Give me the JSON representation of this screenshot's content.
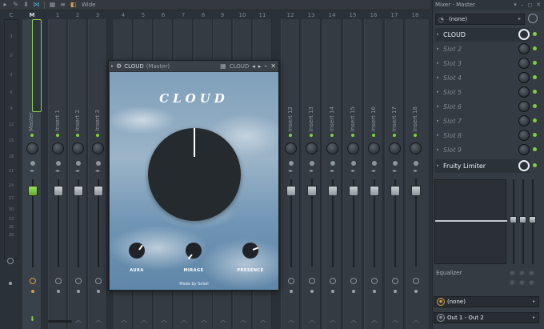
{
  "toolbar": {
    "mode_label": "Wide"
  },
  "columns": {
    "headers": [
      "C",
      "M",
      "1",
      "2",
      "3",
      "4",
      "5",
      "6",
      "7",
      "8",
      "9",
      "10",
      "11",
      "12",
      "13",
      "14",
      "15",
      "16",
      "17",
      "18"
    ]
  },
  "meter": {
    "ticks": [
      "3",
      "0",
      "3",
      "6",
      "9",
      "12",
      "15",
      "18",
      "21",
      "24",
      "27",
      "30",
      "33",
      "36",
      "39"
    ]
  },
  "strips": {
    "master_label": "Master",
    "inserts_left": [
      "Insert 1",
      "Insert 2",
      "Insert 3"
    ],
    "inserts_right": [
      "Insert 12",
      "Insert 13",
      "Insert 14",
      "Insert 15",
      "Insert 16",
      "Insert 17",
      "Insert 18"
    ]
  },
  "plugin": {
    "window_title": "CLOUD",
    "window_subtitle": "(Master)",
    "preset_name": "CLOUD",
    "logo_text": "CLOUD",
    "knobs": [
      "AURA",
      "MIRAGE",
      "PRESENCE"
    ],
    "credit": "Made by Soleil"
  },
  "mixer_panel": {
    "title": "Mixer - Master",
    "preset_select": "(none)",
    "slots": [
      {
        "label": "CLOUD",
        "active": true
      },
      {
        "label": "Slot 2",
        "active": false
      },
      {
        "label": "Slot 3",
        "active": false
      },
      {
        "label": "Slot 4",
        "active": false
      },
      {
        "label": "Slot 5",
        "active": false
      },
      {
        "label": "Slot 6",
        "active": false
      },
      {
        "label": "Slot 7",
        "active": false
      },
      {
        "label": "Slot 8",
        "active": false
      },
      {
        "label": "Slot 9",
        "active": false
      },
      {
        "label": "Fruity Limiter",
        "active": true
      }
    ],
    "eq_label": "Equalizer",
    "input_select": "(none)",
    "output_select": "Out 1 - Out 2"
  },
  "colors": {
    "accent_green": "#7fd13b",
    "background": "#2a3138",
    "panel": "#343b42"
  }
}
